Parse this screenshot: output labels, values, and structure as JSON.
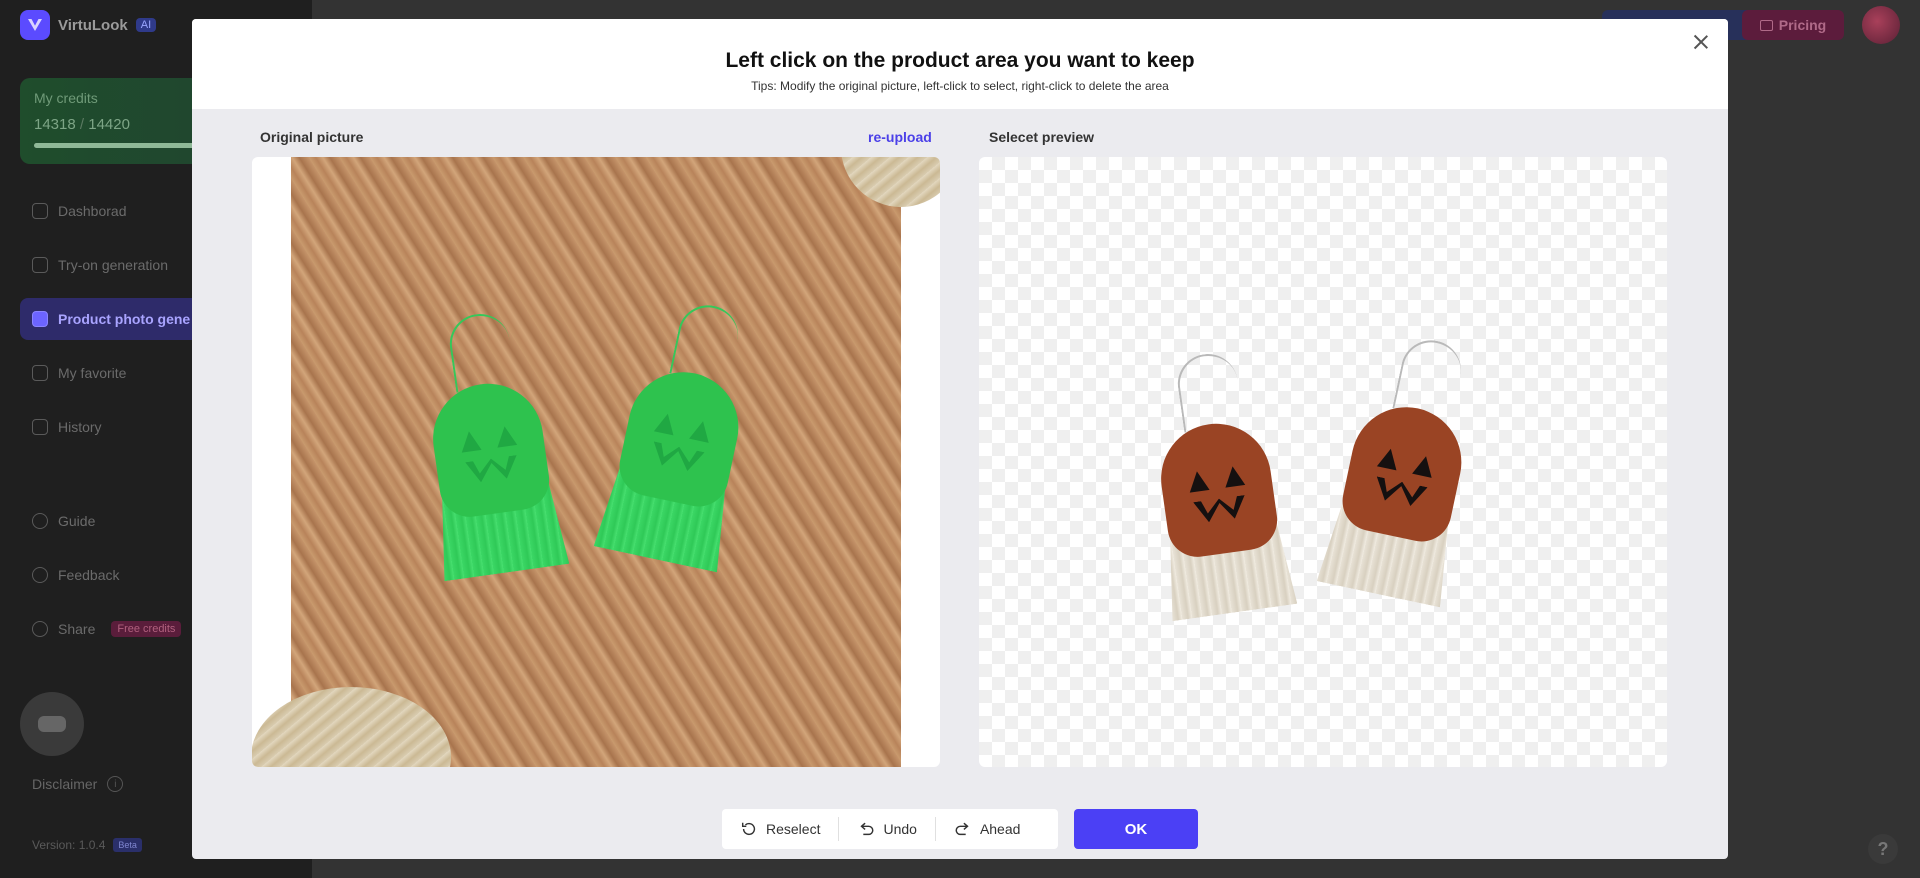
{
  "app": {
    "name": "VirtuLook",
    "ai_badge": "AI",
    "credits_label": "My credits",
    "credits_used": "14318",
    "credits_total": "14420",
    "credits_fraction": 0.99,
    "nav_items": [
      {
        "label": "Dashborad",
        "icon": "dashboard-icon"
      },
      {
        "label": "Try-on generation",
        "icon": "tryon-icon"
      },
      {
        "label": "Product photo gene",
        "icon": "product-photo-icon",
        "active": true
      },
      {
        "label": "My favorite",
        "icon": "heart-icon"
      },
      {
        "label": "History",
        "icon": "clock-icon"
      }
    ],
    "nav_items_2": [
      {
        "label": "Guide",
        "icon": "guide-icon"
      },
      {
        "label": "Feedback",
        "icon": "feedback-icon"
      },
      {
        "label": "Share",
        "icon": "share-icon",
        "badge": "Free credits"
      }
    ],
    "disclaimer": "Disclaimer",
    "version": "Version: 1.0.4",
    "beta": "Beta",
    "pricing": "Pricing",
    "help": "?"
  },
  "modal": {
    "title": "Left click on the product area you want to keep",
    "tips": "Tips: Modify the original picture, left-click to select, right-click to delete the area",
    "original_label": "Original picture",
    "reupload": "re-upload",
    "preview_label": "Selecet preview",
    "toolbar": {
      "reselect": "Reselect",
      "undo": "Undo",
      "ahead": "Ahead"
    },
    "ok": "OK"
  },
  "colors": {
    "accent": "#4b40f5",
    "link": "#4b40e8"
  }
}
